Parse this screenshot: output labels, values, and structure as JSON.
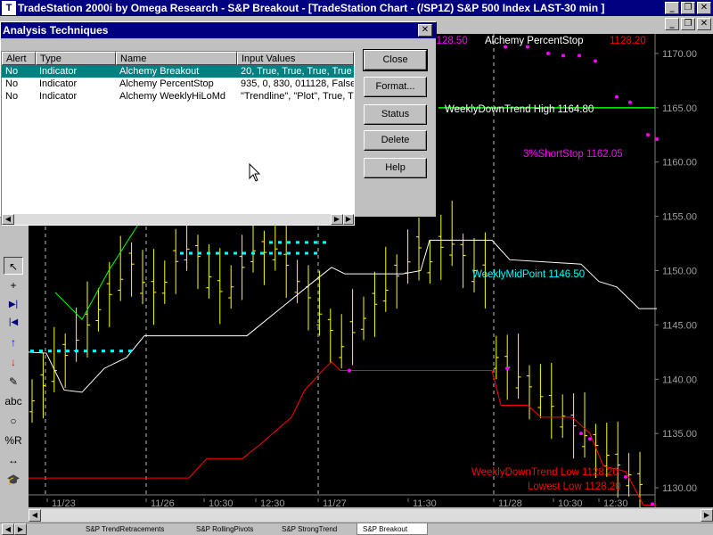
{
  "app": {
    "title": "TradeStation 2000i by Omega Research - S&P Breakout - [TradeStation Chart - (/SP1Z) S&P 500 Index LAST-30 min ]",
    "icon_label": "T"
  },
  "window_buttons": {
    "minimize": "_",
    "restore": "❐",
    "close": "✕"
  },
  "dialog": {
    "title": "Analysis Techniques",
    "columns": [
      "Alert",
      "Type",
      "Name",
      "Input Values"
    ],
    "rows": [
      {
        "alert": "No",
        "type": "Indicator",
        "name": "Alchemy Breakout",
        "inputs": "20, True, True, True, True",
        "selected": true
      },
      {
        "alert": "No",
        "type": "Indicator",
        "name": "Alchemy PercentStop",
        "inputs": "935, 0, 830, 011128, False",
        "selected": false
      },
      {
        "alert": "No",
        "type": "Indicator",
        "name": "Alchemy WeeklyHiLoMd",
        "inputs": "\"Trendline\", \"Plot\", True, T",
        "selected": false
      }
    ],
    "buttons": [
      "Close",
      "Format...",
      "Status",
      "Delete",
      "Help"
    ],
    "close_glyph": "✕"
  },
  "toolbar": {
    "tools": [
      {
        "name": "pointer-tool",
        "glyph": "↖"
      },
      {
        "name": "crosshair-tool",
        "glyph": "+"
      },
      {
        "name": "next-bar-tool",
        "glyph": "▶|"
      },
      {
        "name": "prev-bar-tool",
        "glyph": "|◀"
      },
      {
        "name": "up-arrow-tool",
        "glyph": "↑"
      },
      {
        "name": "down-arrow-tool",
        "glyph": "↓"
      },
      {
        "name": "pencil-tool",
        "glyph": "✎"
      },
      {
        "name": "text-tool",
        "glyph": "abc"
      },
      {
        "name": "ellipse-tool",
        "glyph": "○"
      },
      {
        "name": "percent-retracement-tool",
        "glyph": "%R"
      },
      {
        "name": "horizontal-extend-tool",
        "glyph": "↔"
      },
      {
        "name": "grad-cap-tool",
        "glyph": "🎓"
      }
    ]
  },
  "tabs": [
    "S&P TrendRetracements",
    "S&P RollingPivots",
    "S&P StrongTrend",
    "S&P Breakout"
  ],
  "active_tab": "S&P Breakout",
  "chart_data": {
    "type": "line",
    "y_axis": {
      "ticks": [
        "1170.00",
        "1165.00",
        "1160.00",
        "1155.00",
        "1150.00",
        "1145.00",
        "1140.00",
        "1135.00",
        "1130.00"
      ],
      "range": [
        1128.2,
        1171.8
      ],
      "side": "right"
    },
    "x_axis": {
      "ticks": [
        "11/23",
        "11/26",
        "10:30",
        "12:30",
        "11/27",
        "11:30",
        "11/28",
        "10:30",
        "12:30"
      ]
    },
    "annotations": [
      {
        "text": "1128.50",
        "color": "#ff00ff"
      },
      {
        "text": "Alchemy PercentStop",
        "color": "#ffffff"
      },
      {
        "text": "1128.20",
        "color": "#ff0000"
      },
      {
        "text": "WeeklyDownTrend High 1164.80",
        "color": "#ffffff"
      },
      {
        "text": "3%ShortStop 1162.05",
        "color": "#ff00ff"
      },
      {
        "text": "WeeklyMidPoint 1146.50",
        "color": "#00ffff"
      },
      {
        "text": "WeeklyDownTrend Low 1128.20",
        "color": "#ff0000"
      },
      {
        "text": "Lowest Low 1128.20",
        "color": "#ff0000"
      }
    ],
    "series": [
      {
        "name": "WeeklyDownTrend High",
        "color": "#00ff00",
        "y": [
          1165.0,
          1165.0,
          1165.0,
          1165.0,
          1165.0,
          1165.0,
          1165.0,
          1165.0,
          1165.0,
          1165.0,
          1165.0,
          1165.0,
          1165.0,
          1165.0,
          1165.0,
          1165.0,
          1165.0,
          1165.0
        ]
      },
      {
        "name": "WeeklyMidPoint",
        "color": "#00ffff",
        "y": [
          1150.6,
          1150.6,
          1150.6,
          1150.6,
          1150.6,
          1150.6,
          1150.6,
          1150.6,
          1150.6,
          1150.6,
          1150.6,
          1150.6,
          1150.6,
          1150.6,
          1150.6,
          1150.6,
          1150.6,
          1150.6
        ]
      },
      {
        "name": "WeeklyDownTrend Low",
        "color": "#ff0000",
        "y": [
          1140.8,
          1140.8,
          1140.8,
          1140.8,
          1140.8,
          1140.8,
          1140.8,
          1140.8,
          1140.8,
          1140.8,
          1140.8,
          1140.8,
          1140.8,
          1140.8,
          1140.8,
          1140.8,
          1140.8,
          1140.8
        ]
      },
      {
        "name": "Alchemy Breakout",
        "color": "#00ffff",
        "y": [
          1142.6,
          1142.6,
          1142.6,
          1142.6,
          1142.6,
          1142.6,
          1142.6,
          1142.6,
          1142.6,
          1142.6,
          1142.6,
          1142.6,
          1142.6,
          1142.6,
          1142.6,
          1142.6,
          1142.6,
          1142.6
        ]
      },
      {
        "name": "Alchemy PercentStop",
        "color": "#ff00ff",
        "y": [
          1170.0,
          1170.0,
          1170.0,
          1170.0,
          1170.0,
          1170.0,
          1170.0,
          1170.0,
          1170.0,
          1170.0,
          1170.0,
          1170.0,
          1170.0,
          1170.0,
          1170.0,
          1170.0,
          1170.0,
          1170.0
        ]
      }
    ],
    "grid": false
  }
}
